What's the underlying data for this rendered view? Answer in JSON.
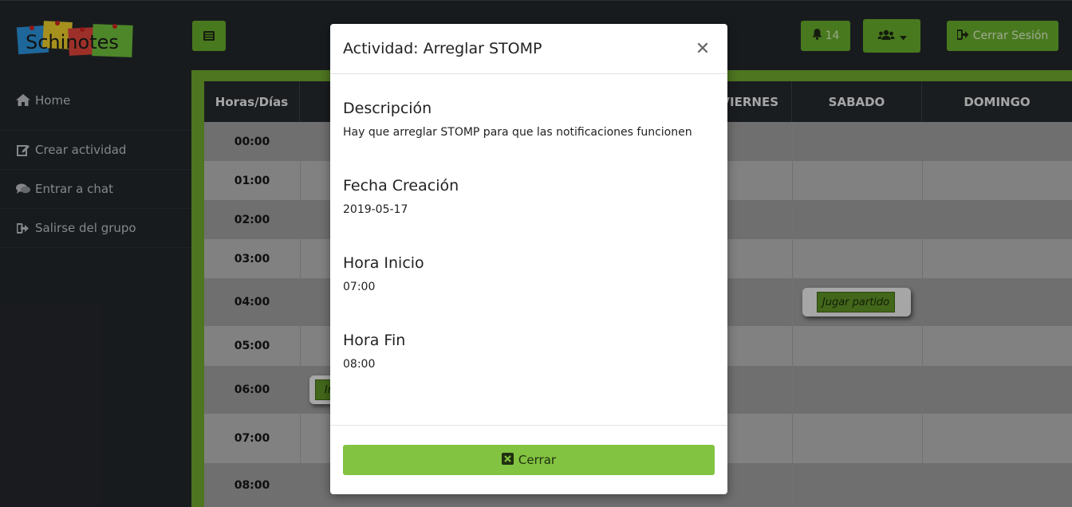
{
  "header": {
    "logo_text": "Schinotes",
    "notifications_count": "14",
    "logout_label": "Cerrar Sesión"
  },
  "sidebar": {
    "items": [
      {
        "label": "Home",
        "icon": "home-icon"
      },
      {
        "label": "Crear actividad",
        "icon": "edit-icon"
      },
      {
        "label": "Entrar a chat",
        "icon": "comments-icon"
      },
      {
        "label": "Salirse del grupo",
        "icon": "sign-out-icon"
      }
    ]
  },
  "calendar": {
    "headers": [
      "Horas/Días",
      "",
      "",
      "",
      "VIERNES",
      "SABADO",
      "DOMINGO"
    ],
    "hours": [
      "00:00",
      "01:00",
      "02:00",
      "03:00",
      "04:00",
      "05:00",
      "06:00",
      "07:00",
      "08:00"
    ],
    "events": [
      {
        "label": "Jugar partido"
      },
      {
        "label": "Ir"
      }
    ]
  },
  "modal": {
    "title": "Actividad: Arreglar STOMP",
    "fields": [
      {
        "label": "Descripción",
        "value": "Hay que arreglar STOMP para que las notificaciones funcionen"
      },
      {
        "label": "Fecha Creación",
        "value": "2019-05-17"
      },
      {
        "label": "Hora Inicio",
        "value": "07:00"
      },
      {
        "label": "Hora Fin",
        "value": "08:00"
      }
    ],
    "close_label": "Cerrar"
  },
  "colors": {
    "accent": "#66a82c",
    "button_green": "#82c341",
    "dark": "#22262a"
  }
}
